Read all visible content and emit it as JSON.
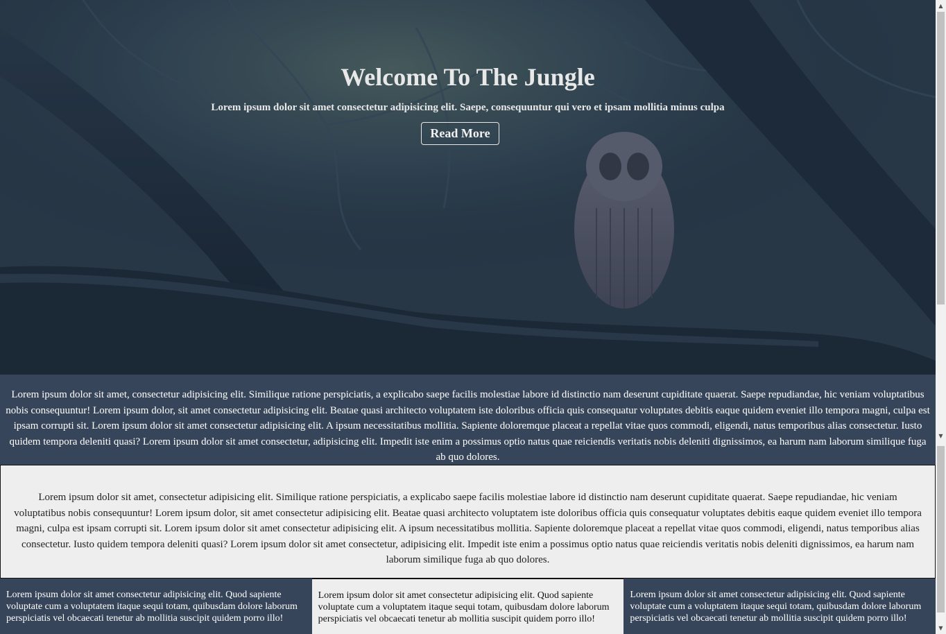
{
  "hero": {
    "title": "Welcome To The Jungle",
    "subtitle": "Lorem ipsum dolor sit amet consectetur adipisicing elit. Saepe, consequuntur qui vero et ipsam mollitia minus culpa",
    "button_label": "Read More",
    "image": "owl-on-branch-night-forest"
  },
  "band_dark": {
    "text": "Lorem ipsum dolor sit amet, consectetur adipisicing elit. Similique ratione perspiciatis, a explicabo saepe facilis molestiae labore id distinctio nam deserunt cupiditate quaerat. Saepe repudiandae, hic veniam voluptatibus nobis consequuntur! Lorem ipsum dolor, sit amet consectetur adipisicing elit. Beatae quasi architecto voluptatem iste doloribus officia quis consequatur voluptates debitis eaque quidem eveniet illo tempora magni, culpa est ipsam corrupti sit. Lorem ipsum dolor sit amet consectetur adipisicing elit. A ipsum necessitatibus mollitia. Sapiente doloremque placeat a repellat vitae quos commodi, eligendi, natus temporibus alias consectetur. Iusto quidem tempora deleniti quasi? Lorem ipsum dolor sit amet consectetur, adipisicing elit. Impedit iste enim a possimus optio natus quae reiciendis veritatis nobis deleniti dignissimos, ea harum nam laborum similique fuga ab quo dolores."
  },
  "band_light": {
    "text": "Lorem ipsum dolor sit amet, consectetur adipisicing elit. Similique ratione perspiciatis, a explicabo saepe facilis molestiae labore id distinctio nam deserunt cupiditate quaerat. Saepe repudiandae, hic veniam voluptatibus nobis consequuntur! Lorem ipsum dolor, sit amet consectetur adipisicing elit. Beatae quasi architecto voluptatem iste doloribus officia quis consequatur voluptates debitis eaque quidem eveniet illo tempora magni, culpa est ipsam corrupti sit. Lorem ipsum dolor sit amet consectetur adipisicing elit. A ipsum necessitatibus mollitia. Sapiente doloremque placeat a repellat vitae quos commodi, eligendi, natus temporibus alias consectetur. Iusto quidem tempora deleniti quasi? Lorem ipsum dolor sit amet consectetur, adipisicing elit. Impedit iste enim a possimus optio natus quae reiciendis veritatis nobis deleniti dignissimos, ea harum nam laborum similique fuga ab quo dolores."
  },
  "columns": [
    {
      "text": "Lorem ipsum dolor sit amet consectetur adipisicing elit. Quod sapiente voluptate cum a voluptatem itaque sequi totam, quibusdam dolore laborum perspiciatis vel obcaecati tenetur ab mollitia suscipit quidem porro illo!"
    },
    {
      "text": "Lorem ipsum dolor sit amet consectetur adipisicing elit. Quod sapiente voluptate cum a voluptatem itaque sequi totam, quibusdam dolore laborum perspiciatis vel obcaecati tenetur ab mollitia suscipit quidem porro illo!"
    },
    {
      "text": "Lorem ipsum dolor sit amet consectetur adipisicing elit. Quod sapiente voluptate cum a voluptatem itaque sequi totam, quibusdam dolore laborum perspiciatis vel obcaecati tenetur ab mollitia suscipit quidem porro illo!"
    }
  ],
  "colors": {
    "dark_band": "#364559",
    "light_band": "#eeeeee",
    "hero_text": "#e8e8e8"
  },
  "scrollbar": {
    "up_icon": "arrow-up-icon",
    "down_icon": "arrow-down-icon"
  }
}
